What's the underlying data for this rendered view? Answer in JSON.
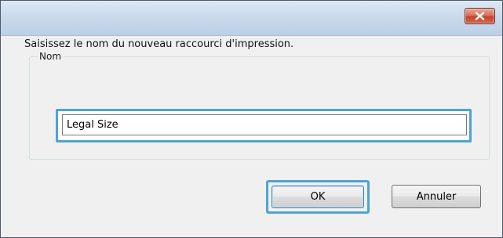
{
  "window": {
    "title": "",
    "close_icon": "close-x-icon",
    "close_color": "#c5432b"
  },
  "group": {
    "legend": "Nom",
    "instruction": "Saisissez le nom du nouveau raccourci d'impression."
  },
  "name_field": {
    "value": "Legal Size",
    "placeholder": ""
  },
  "buttons": {
    "ok_label": "OK",
    "cancel_label": "Annuler"
  },
  "colors": {
    "focus_ring": "#4ea4d3",
    "dialog_bg": "#f0f0f0"
  }
}
